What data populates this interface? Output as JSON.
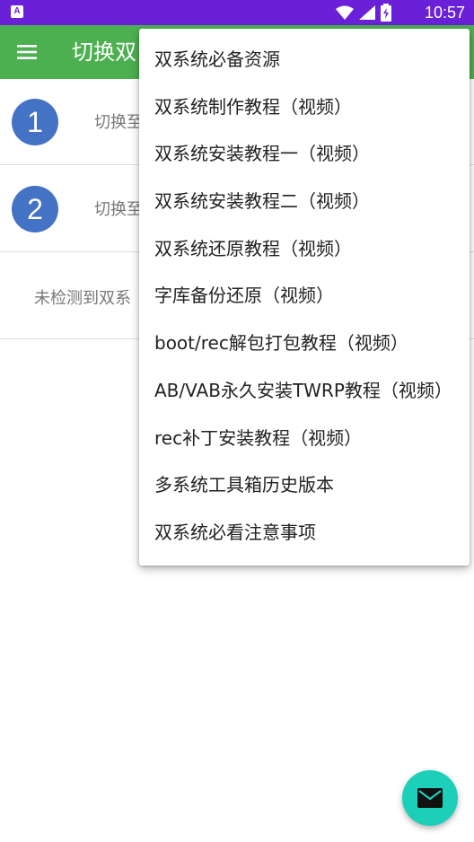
{
  "status_bar": {
    "app_badge": "A",
    "time": "10:57",
    "icons": [
      "wifi-icon",
      "signal-icon",
      "battery-icon"
    ]
  },
  "app_bar": {
    "title": "切换双",
    "menu_icon": "hamburger-menu-icon"
  },
  "slots": [
    {
      "number": "1",
      "label": "切换至"
    },
    {
      "number": "2",
      "label": "切换至"
    }
  ],
  "status_text": "未检测到双系",
  "menu": {
    "items": [
      "双系统必备资源",
      "双系统制作教程（视频）",
      "双系统安装教程一（视频）",
      "双系统安装教程二（视频）",
      "双系统还原教程（视频）",
      "字库备份还原（视频）",
      "boot/rec解包打包教程（视频）",
      "AB/VAB永久安装TWRP教程（视频）",
      "rec补丁安装教程（视频）",
      "多系统工具箱历史版本",
      "双系统必看注意事项"
    ]
  },
  "fab": {
    "icon": "mail-icon"
  },
  "colors": {
    "status_bar": "#6a20d6",
    "app_bar": "#4caf50",
    "number_badge": "#4472c4",
    "fab": "#1ccfb9"
  }
}
